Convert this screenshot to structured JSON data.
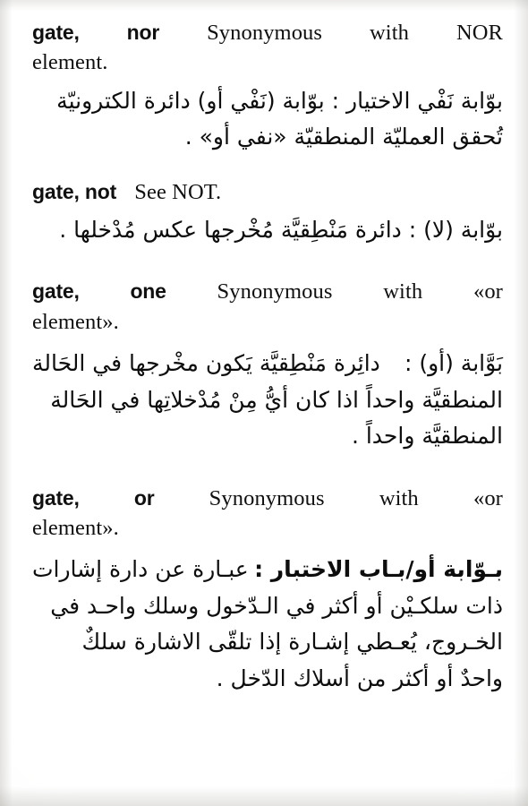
{
  "page": {
    "kind": "scanned-dictionary-page",
    "language_pair": "English-Arabic",
    "ink_color": "#101010",
    "paper_color": "#ffffff"
  },
  "entries": [
    {
      "id": "gate-nor",
      "headword": "gate,",
      "sense": "nor",
      "english_lines": [
        [
          "gate,",
          "nor",
          "Synonymous",
          "with",
          "NOR"
        ],
        [
          "element."
        ]
      ],
      "english_plain": "gate, nor  Synonymous with NOR element.",
      "arabic_lines": [
        [
          "بوّابة نَفْي الاختيار : بوّابة (نَفْي أو) دائرة الكترونيّة"
        ],
        [
          "تُحقق العمليّة المنطقيّة «نفي أو» ."
        ]
      ],
      "arabic_plain": "بوّابة نَفْي الاختيار : بوّابة (نَفْي أو) دائرة الكترونيّة تُحقق العمليّة المنطقيّة «نفي أو» ."
    },
    {
      "id": "gate-not",
      "headword": "gate,",
      "sense": "not",
      "english_lines": [
        [
          "gate, not",
          "See NOT."
        ]
      ],
      "english_plain": "gate, not  See NOT.",
      "arabic_lines": [
        [
          "بوّابة (لا) : دائرة مَنْطِقيَّة مُخْرجها عكس مُدْخلها ."
        ]
      ],
      "arabic_plain": "بوّابة (لا) : دائرة مَنْطِقيَّة مُخْرجها عكس مُدْخلها ."
    },
    {
      "id": "gate-one",
      "headword": "gate,",
      "sense": "one",
      "english_lines": [
        [
          "gate,",
          "one",
          "Synonymous",
          "with",
          "«or"
        ],
        [
          "element»."
        ]
      ],
      "english_plain": "gate, one  Synonymous with «or element».",
      "arabic_lines": [
        [
          "بَوَّابة (أو) :",
          "دائِرة مَنْطِقيَّة يَكون مخْرجها في الحَالة"
        ],
        [
          "المنطقيَّة واحداً اذا كان أيُّ مِنْ مُدْخلاتِها في الحَالة"
        ],
        [
          "المنطقيَّة واحداً ."
        ]
      ],
      "arabic_plain": "بَوَّابة (أو) : دائِرة مَنْطِقيَّة يَكون مخْرجها في الحَالة المنطقيَّة واحداً اذا كان أيُّ مِنْ مُدْخلاتِها في الحَالة المنطقيَّة واحداً ."
    },
    {
      "id": "gate-or",
      "headword": "gate,",
      "sense": "or",
      "english_lines": [
        [
          "gate,",
          "or",
          "Synonymous",
          "with",
          "«or"
        ],
        [
          "element»."
        ]
      ],
      "english_plain": "gate, or  Synonymous with «or element».",
      "arabic_lines": [
        [
          "بـوّابة أو/بـاب الاختبار :",
          "عبـارة عن دارة إشارات"
        ],
        [
          "ذات سلكـيْن أو أكثر في الـدّخول وسلك واحـد في"
        ],
        [
          "الخـروج، يُعـطي إشـارة إذا تلقّى الاشارة سلكٌ"
        ],
        [
          "واحدٌ أو أكثر من أسلاك الدّخل ."
        ]
      ],
      "arabic_plain": "بـوّابة أو/بـاب الاختبار : عبـارة عن دارة إشارات ذات سلكـيْن أو أكثر في الـدّخول وسلك واحـد في الخـروج، يُعـطي إشـارة إذا تلقّى الاشارة سلكٌ واحدٌ أو أكثر من أسلاك الدّخل ."
    }
  ]
}
